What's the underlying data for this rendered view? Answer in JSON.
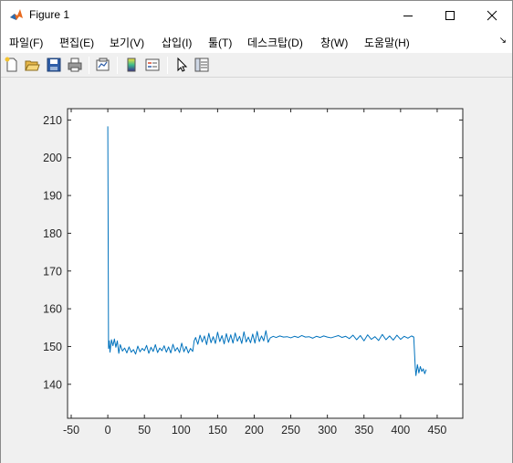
{
  "window": {
    "title": "Figure 1",
    "icons": {
      "app": "matlab-icon",
      "minimize": "minimize-icon",
      "maximize": "maximize-icon",
      "close": "close-icon"
    }
  },
  "menubar": {
    "items": [
      "파일(F)",
      "편집(E)",
      "보기(V)",
      "삽입(I)",
      "툴(T)",
      "데스크탑(D)",
      "창(W)",
      "도움말(H)"
    ],
    "overflow_icon": "dock-arrow-icon"
  },
  "toolbar": {
    "buttons": [
      "new-figure-icon",
      "open-file-icon",
      "save-icon",
      "print-icon",
      "link-plot-icon",
      "insert-colorbar-icon",
      "insert-legend-icon",
      "edit-plot-icon",
      "open-property-inspector-icon"
    ]
  },
  "chart_data": {
    "type": "line",
    "title": "",
    "xlabel": "",
    "ylabel": "",
    "xlim": [
      -55,
      485
    ],
    "ylim": [
      131,
      213
    ],
    "xticks": [
      -50,
      0,
      50,
      100,
      150,
      200,
      250,
      300,
      350,
      400,
      450
    ],
    "yticks": [
      140,
      150,
      160,
      170,
      180,
      190,
      200,
      210
    ],
    "grid": false,
    "legend": "none",
    "line_color": "#0072BD",
    "series": [
      {
        "x": [
          0,
          1,
          2,
          3,
          5,
          7,
          9,
          11,
          13,
          15,
          17,
          20,
          23,
          26,
          29,
          32,
          35,
          38,
          41,
          44,
          47,
          50,
          53,
          56,
          59,
          62,
          65,
          68,
          71,
          74,
          77,
          80,
          83,
          86,
          89,
          92,
          95,
          98,
          101,
          104,
          107,
          110,
          113,
          116,
          118,
          120,
          123,
          126,
          129,
          132,
          135,
          138,
          141,
          144,
          147,
          150,
          153,
          156,
          159,
          162,
          165,
          168,
          171,
          174,
          177,
          180,
          183,
          186,
          189,
          192,
          195,
          198,
          201,
          204,
          207,
          210,
          213,
          216,
          219,
          222,
          226,
          230,
          235,
          240,
          245,
          250,
          255,
          260,
          265,
          270,
          275,
          280,
          285,
          290,
          295,
          300,
          305,
          310,
          315,
          320,
          325,
          330,
          335,
          340,
          345,
          350,
          355,
          360,
          365,
          370,
          375,
          380,
          385,
          390,
          395,
          400,
          405,
          410,
          415,
          418,
          420,
          421,
          423,
          425,
          427,
          429,
          431,
          433,
          435
        ],
        "y": [
          208.3,
          149.5,
          151.5,
          148.5,
          151.8,
          150.2,
          152.0,
          149.8,
          151.5,
          148.2,
          150.5,
          148.8,
          149.6,
          148.3,
          149.9,
          148.5,
          149.2,
          148.0,
          150.1,
          148.6,
          149.5,
          148.9,
          150.3,
          148.2,
          149.8,
          148.7,
          150.5,
          148.4,
          149.6,
          148.9,
          150.2,
          148.5,
          149.9,
          148.3,
          150.6,
          148.8,
          149.7,
          148.4,
          150.9,
          148.6,
          150.0,
          148.3,
          149.5,
          148.7,
          151.5,
          152.4,
          150.6,
          153.0,
          151.2,
          152.8,
          150.5,
          153.5,
          151.0,
          152.6,
          150.8,
          153.8,
          151.3,
          152.9,
          150.7,
          153.4,
          151.1,
          153.1,
          150.9,
          153.6,
          151.4,
          152.7,
          150.8,
          153.9,
          151.2,
          152.5,
          151.0,
          153.3,
          150.9,
          154.0,
          151.3,
          152.8,
          151.5,
          154.2,
          151.1,
          152.3,
          152.7,
          152.4,
          152.8,
          152.5,
          152.6,
          152.3,
          152.7,
          152.4,
          152.9,
          152.5,
          152.6,
          152.2,
          152.7,
          152.4,
          152.8,
          152.5,
          152.3,
          152.6,
          152.9,
          152.4,
          152.7,
          152.1,
          153.0,
          151.8,
          152.9,
          151.5,
          153.1,
          151.9,
          152.6,
          151.6,
          153.2,
          151.8,
          152.8,
          151.7,
          153.0,
          151.9,
          152.7,
          152.2,
          152.8,
          152.5,
          144.6,
          142.3,
          145.2,
          143.0,
          144.7,
          143.4,
          144.1,
          142.8,
          143.9
        ]
      }
    ]
  }
}
